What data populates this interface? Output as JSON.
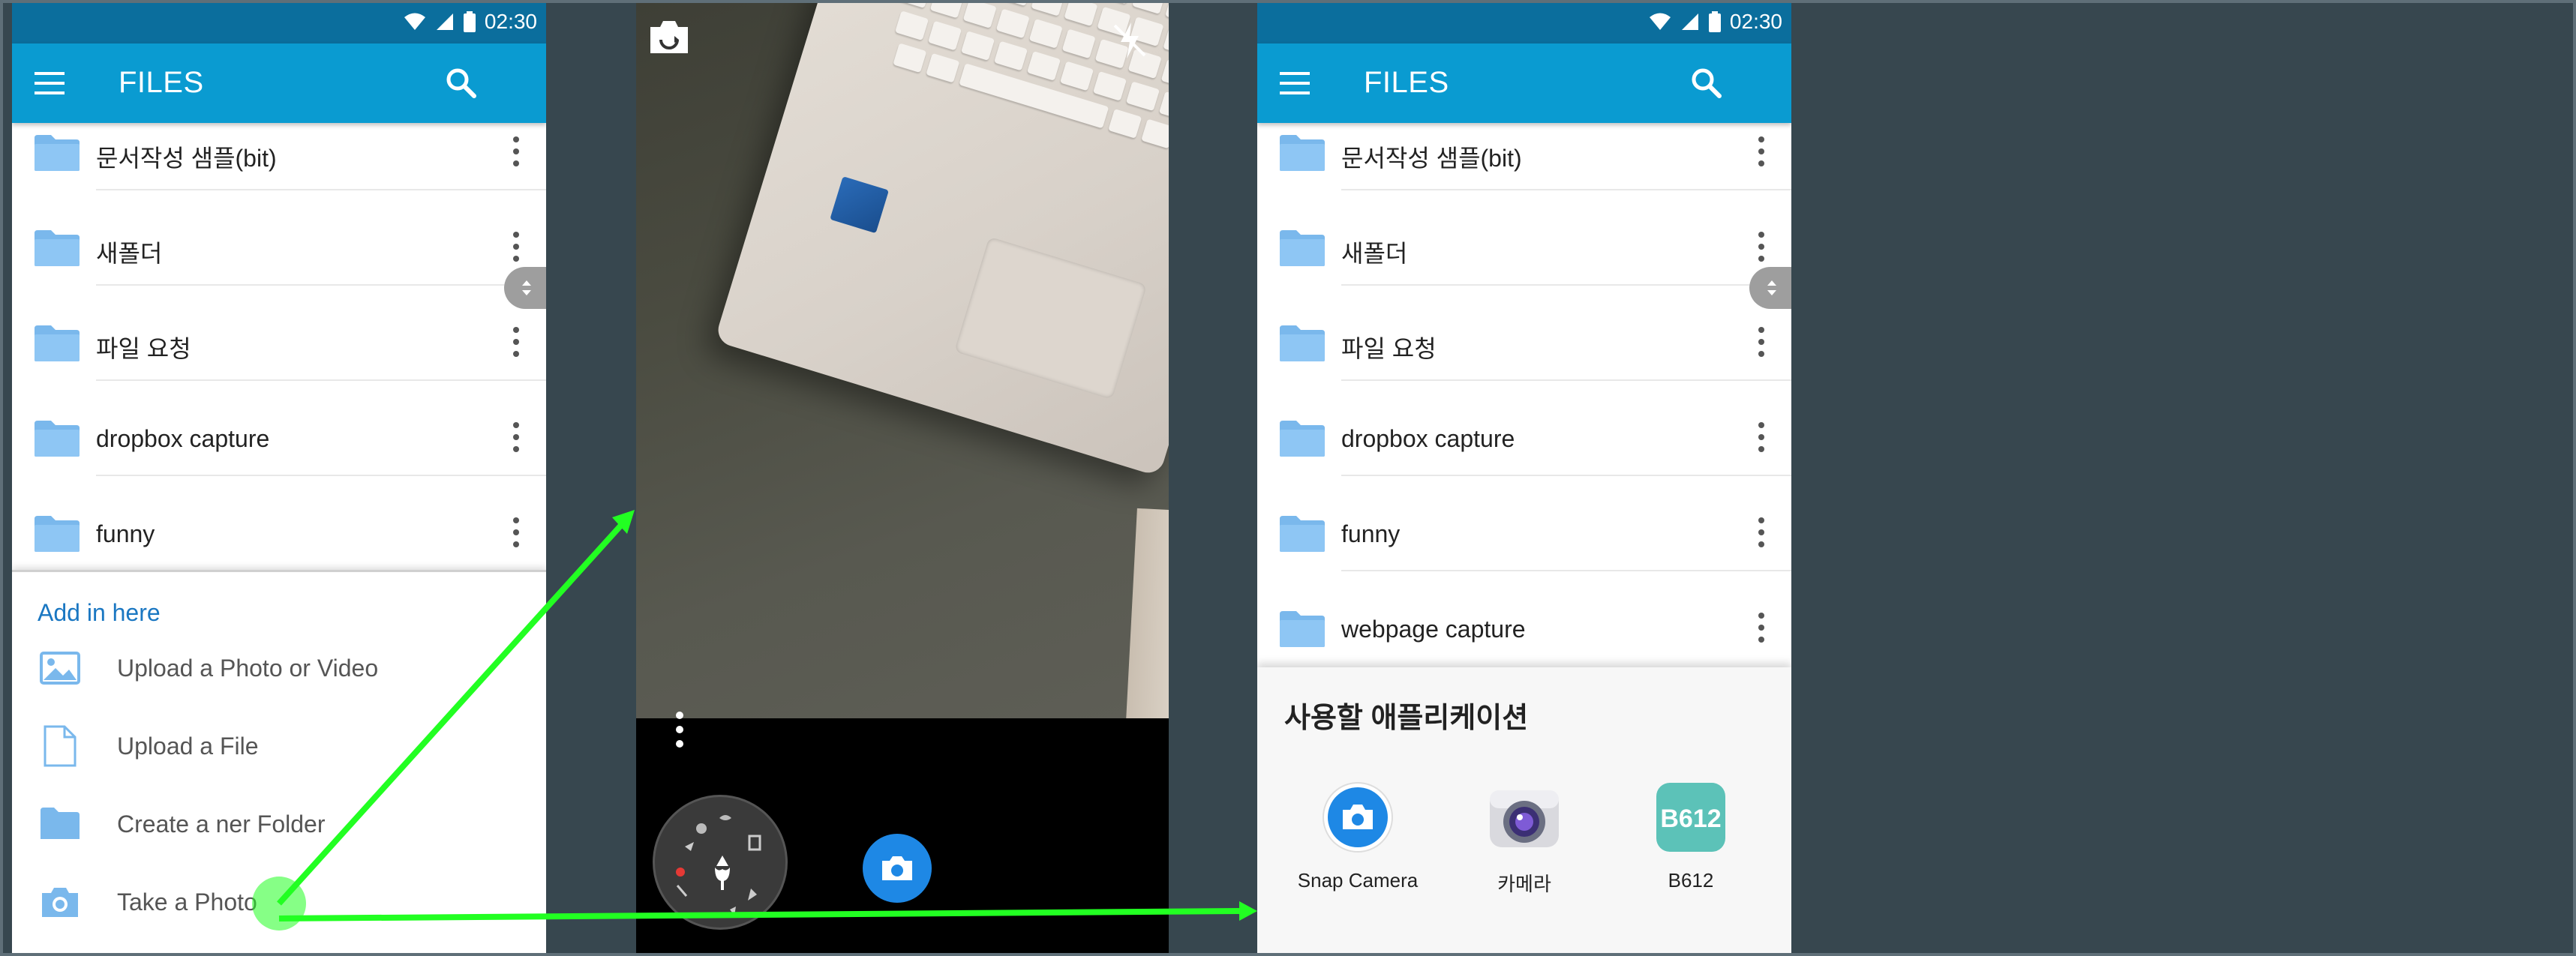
{
  "status_time": "02:30",
  "app_title": "FILES",
  "panel1": {
    "folders": [
      "문서작성 샘플(bit)",
      "새폴더",
      "파일 요청",
      "dropbox capture",
      "funny"
    ],
    "add_heading": "Add in here",
    "actions": [
      "Upload a Photo or Video",
      "Upload a File",
      "Create a ner Folder",
      "Take a Photo"
    ]
  },
  "panel3": {
    "folders": [
      "문서작성 샘플(bit)",
      "새폴더",
      "파일 요청",
      "dropbox capture",
      "funny",
      "webpage capture"
    ],
    "chooser_title": "사용할 애플리케이션",
    "apps": [
      "Snap Camera",
      "카메라",
      "B612"
    ]
  },
  "colors": {
    "status_bar": "#0b6e9d",
    "app_bar": "#0a9bd1",
    "accent": "#1a77c2",
    "arrow": "#22ff22",
    "background": "#37474f"
  }
}
